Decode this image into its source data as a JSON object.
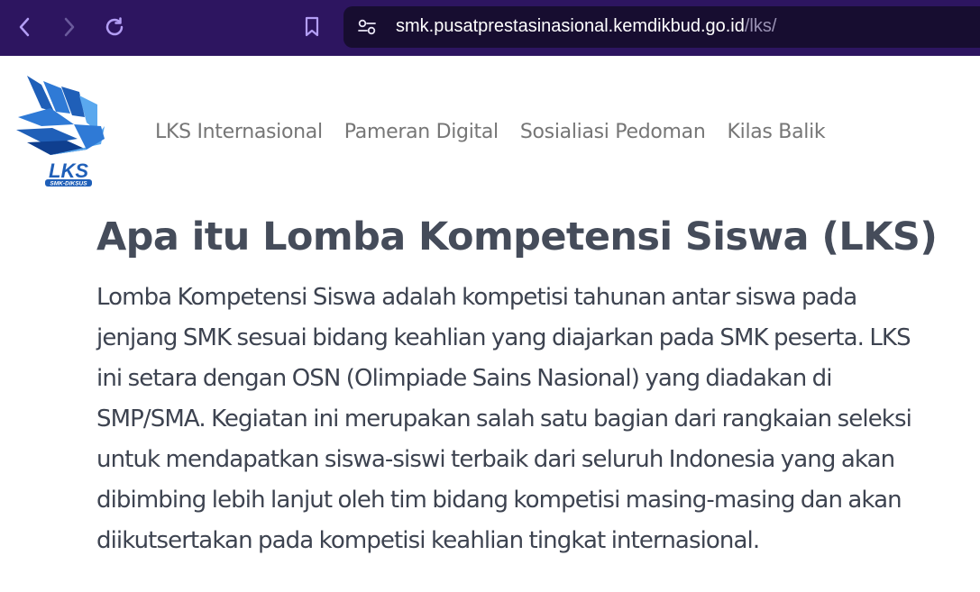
{
  "browser": {
    "url_host": "smk.pusatprestasinasional.kemdikbud.go.id",
    "url_path": "/lks/",
    "icons": [
      "back-icon",
      "forward-icon",
      "reload-icon",
      "bookmark-icon",
      "site-settings-icon"
    ]
  },
  "logo": {
    "text": "LKS",
    "subtext": "SMK-DIKSUS"
  },
  "nav": {
    "items": [
      {
        "label": "LKS Internasional"
      },
      {
        "label": "Pameran Digital"
      },
      {
        "label": "Sosialiasi Pedoman"
      },
      {
        "label": "Kilas Balik"
      }
    ]
  },
  "main": {
    "heading": "Apa itu Lomba Kompetensi Siswa (LKS)",
    "paragraph_lines": [
      "Lomba Kompetensi Siswa adalah kompetisi tahunan antar siswa pada",
      "jenjang SMK sesuai bidang keahlian yang diajarkan pada SMK peserta. LKS",
      "ini setara dengan OSN (Olimpiade Sains Nasional) yang diadakan di",
      "SMP/SMA. Kegiatan ini merupakan salah satu bagian dari rangkaian seleksi",
      "untuk mendapatkan siswa-siswi terbaik dari seluruh Indonesia yang akan",
      "dibimbing lebih lanjut oleh tim bidang kompetisi masing-masing dan akan",
      "diikutsertakan pada kompetisi keahlian tingkat internasional."
    ]
  },
  "colors": {
    "browser_bar": "#2d1560",
    "address_bar": "#170d30",
    "icon": "#b39ef5",
    "heading": "#454c5a",
    "nav_text": "#767676",
    "logo_blue": "#1f5fb8"
  }
}
